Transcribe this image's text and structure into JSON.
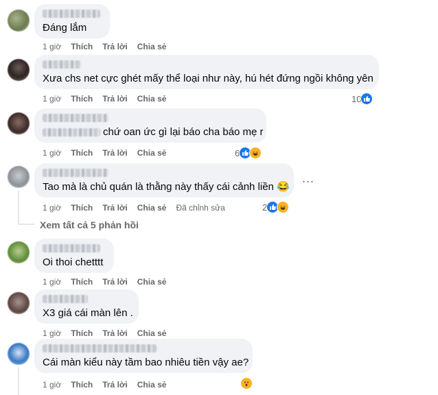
{
  "comments": [
    {
      "text": "Đáng lắm",
      "time": "1 giờ",
      "like": "Thích",
      "reply": "Trả lời",
      "share": "Chia sẻ",
      "reaction_count": "",
      "edited": ""
    },
    {
      "text": "Xưa chs net cực ghét mấy thể loại như này, hú hét đứng ngồi không yên",
      "time": "1 giờ",
      "like": "Thích",
      "reply": "Trả lời",
      "share": "Chia sẻ",
      "reaction_count": "10",
      "edited": ""
    },
    {
      "text": "chứ oan ức gì lại báo cha báo mẹ r",
      "time": "1 giờ",
      "like": "Thích",
      "reply": "Trả lời",
      "share": "Chia sẻ",
      "reaction_count": "6",
      "edited": ""
    },
    {
      "text": "Tao mà là chủ quán là thằng này thấy cái cảnh liền 😂",
      "time": "1 giờ",
      "like": "Thích",
      "reply": "Trả lời",
      "share": "Chia sẻ",
      "reaction_count": "2",
      "edited": "Đã chỉnh sửa"
    },
    {
      "text": "Oi thoi chetttt",
      "time": "1 giờ",
      "like": "Thích",
      "reply": "Trả lời",
      "share": "Chia sẻ",
      "reaction_count": "",
      "edited": ""
    },
    {
      "text": "X3 giá cái màn lên .",
      "time": "1 giờ",
      "like": "Thích",
      "reply": "Trả lời",
      "share": "Chia sẻ",
      "reaction_count": "",
      "edited": ""
    },
    {
      "text": "Cái màn kiểu này tầm bao nhiêu tiền vậy ae?",
      "time": "1 giờ",
      "like": "Thích",
      "reply": "Trả lời",
      "share": "Chia sẻ",
      "reaction_count": "",
      "edited": ""
    }
  ],
  "view_all_replies": "Xem tất cả 5 phản hồi",
  "more_options": "...",
  "colors": {
    "bubble": "#f0f2f5",
    "meta": "#65676b",
    "like_blue": "#1877f2",
    "haha_yellow": "#f7b125"
  },
  "icons": {
    "like": "like-reaction-icon",
    "haha": "haha-reaction-icon",
    "wow": "wow-reaction-icon"
  }
}
